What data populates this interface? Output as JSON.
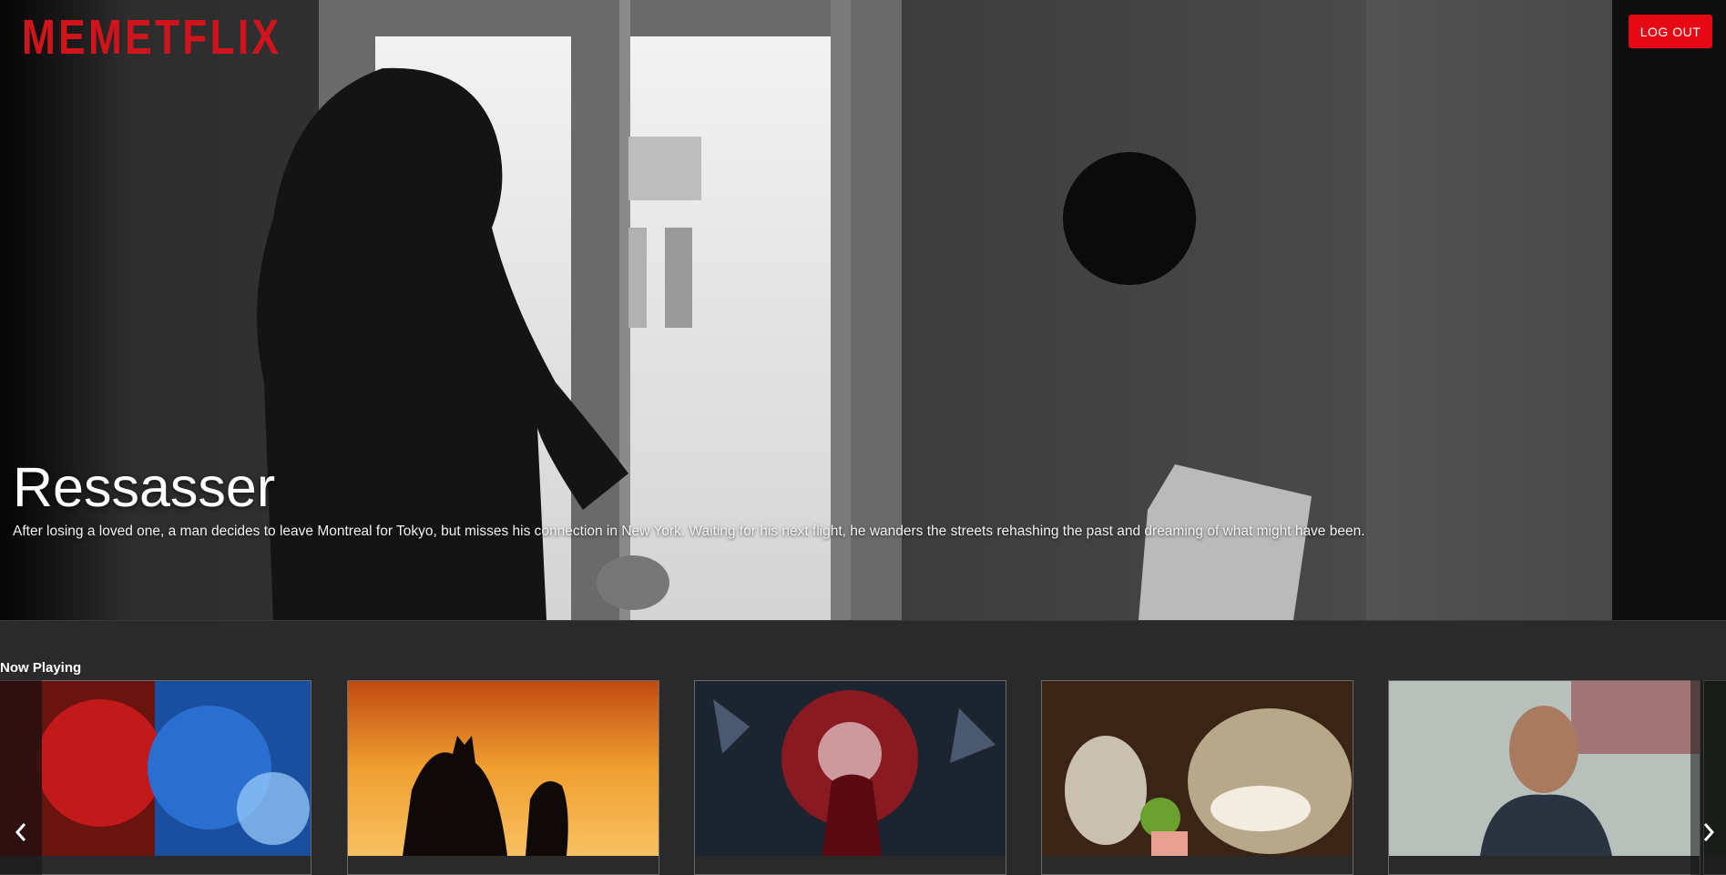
{
  "header": {
    "logo": "MEMETFLIX",
    "logout_label": "LOG OUT"
  },
  "hero": {
    "title": "Ressasser",
    "description": "After losing a loved one, a man decides to leave Montreal for Tokyo, but misses his connection in New York. Waiting for his next flight, he wanders the streets rehashing the past and dreaming of what might have been."
  },
  "row": {
    "title": "Now Playing"
  },
  "colors": {
    "brand": "#d0141c",
    "button": "#e50914",
    "background": "#2a2a2b"
  }
}
